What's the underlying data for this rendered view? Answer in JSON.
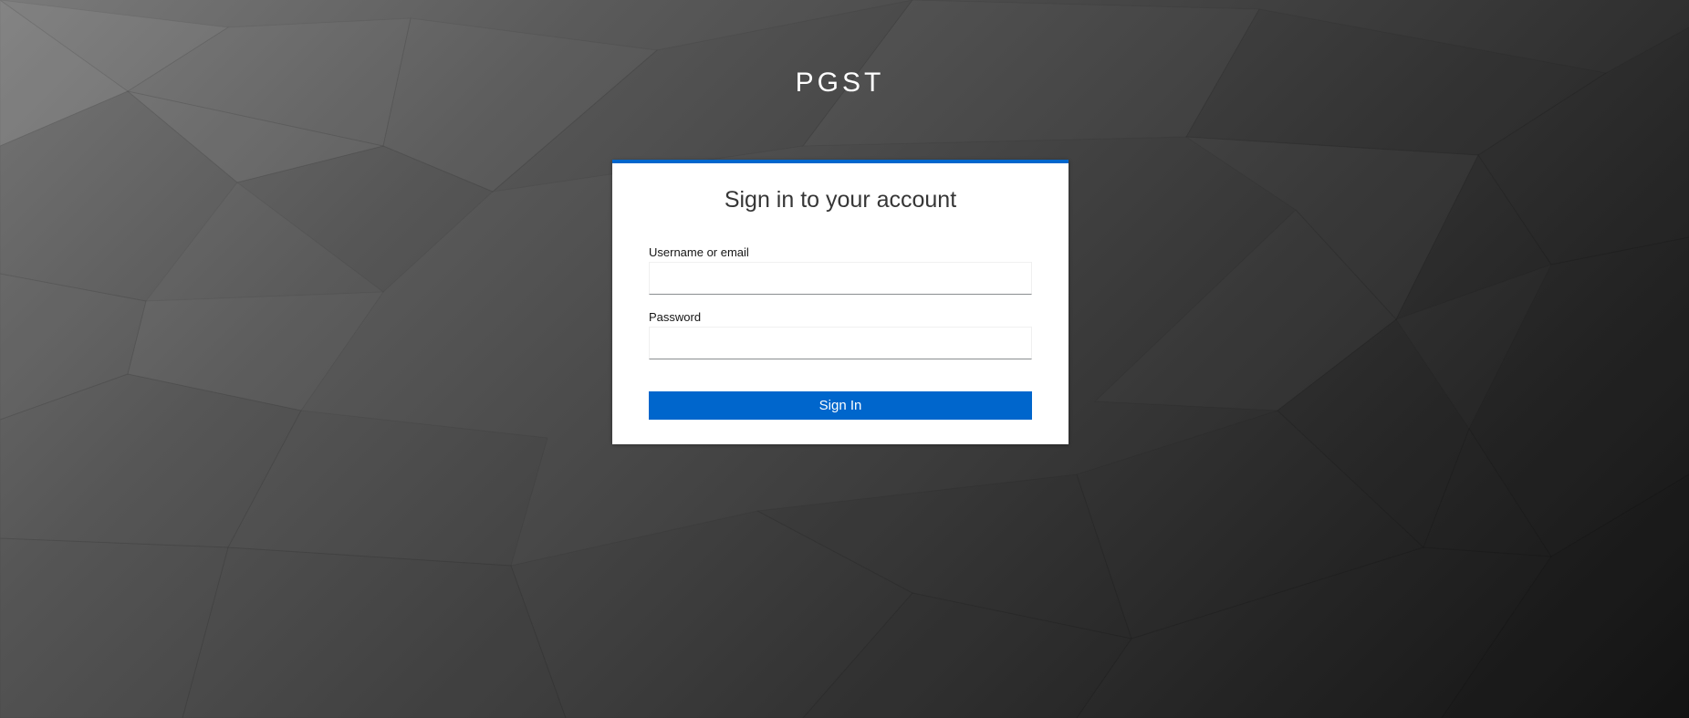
{
  "realm": {
    "name": "PGST"
  },
  "login": {
    "title": "Sign in to your account",
    "username_label": "Username or email",
    "username_value": "",
    "password_label": "Password",
    "password_value": "",
    "submit_label": "Sign In"
  },
  "colors": {
    "accent": "#0066cc",
    "card_background": "#ffffff",
    "background_light": "#7a7a7a",
    "background_dark": "#151515"
  }
}
